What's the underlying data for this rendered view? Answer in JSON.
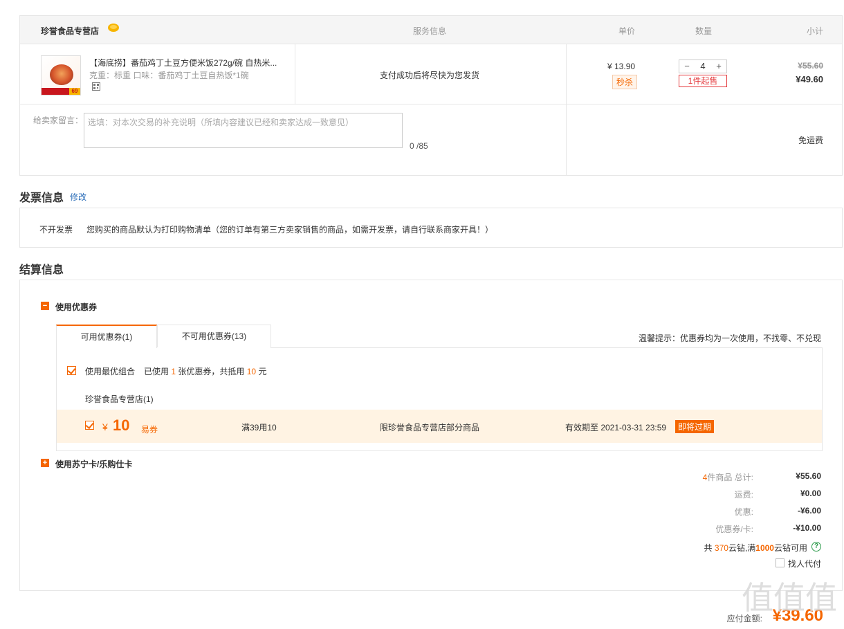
{
  "store": {
    "name": "珍誉食品专营店",
    "col_service": "服务信息",
    "col_price": "单价",
    "col_qty": "数量",
    "col_subtotal": "小计"
  },
  "item": {
    "title": "【海底捞】番茄鸡丁土豆方便米饭272g/碗 自热米...",
    "spec": "克重：标重   口味：番茄鸡丁土豆自热饭*1碗",
    "service": "支付成功后将尽快为您发货",
    "unit_price": "¥ 13.90",
    "seckill_tag": "秒杀",
    "qty_minus": "−",
    "qty_value": "4",
    "qty_plus": "+",
    "min_qty_tag": "1件起售",
    "old_subtotal": "¥55.60",
    "new_subtotal": "¥49.60"
  },
  "message": {
    "label": "给卖家留言：",
    "placeholder": "选填：对本次交易的补充说明（所填内容建议已经和卖家达成一致意见）",
    "count": "0 /85",
    "shipping": "免运费"
  },
  "invoice": {
    "title": "发票信息",
    "edit": "修改",
    "type": "不开发票",
    "note": "您购买的商品默认为打印购物清单（您的订单有第三方卖家销售的商品，如需开发票，请自行联系商家开具！）"
  },
  "settlement": {
    "title": "结算信息",
    "coupon_toggle": "−",
    "coupon_section": "使用优惠券",
    "tab_available": "可用优惠券(1)",
    "tab_unavailable": "不可用优惠券(13)",
    "tip": "温馨提示：优惠券均为一次使用，不找零、不兑现",
    "best_combo_label": "使用最优组合",
    "used_prefix": "已使用",
    "used_count": "1",
    "used_mid": "张优惠券，共抵用",
    "used_amount": "10",
    "used_suffix": "元",
    "store_group": "珍誉食品专营店(1)",
    "coupon": {
      "currency": "¥",
      "amount": "10",
      "type": "易券",
      "condition": "满39用10",
      "scope": "限珍誉食品专营店部分商品",
      "expiry": "有效期至 2021-03-31 23:59",
      "expiring_tag": "即将过期"
    },
    "card_toggle": "+",
    "card_section": "使用苏宁卡/乐购仕卡"
  },
  "summary": {
    "count_num": "4",
    "count_label": "件商品 总计:",
    "total": "¥55.60",
    "shipping_label": "运费:",
    "shipping": "¥0.00",
    "discount_label": "优惠:",
    "discount": "-¥6.00",
    "coupon_label": "优惠券/卡:",
    "coupon": "-¥10.00",
    "diamond_prefix": "共",
    "diamond_count": "370",
    "diamond_mid": "云钻,满",
    "diamond_threshold": "1000",
    "diamond_suffix": "云钻可用",
    "proxy_pay": "找人代付",
    "payable_label": "应付金额:",
    "payable": "¥39.60"
  },
  "watermark": "值值值",
  "colors": {
    "accent": "#f56600",
    "red": "#e4393c",
    "link": "#2a6db8"
  },
  "icons": [
    "store-badge-icon",
    "qr-code-icon",
    "help-icon"
  ]
}
